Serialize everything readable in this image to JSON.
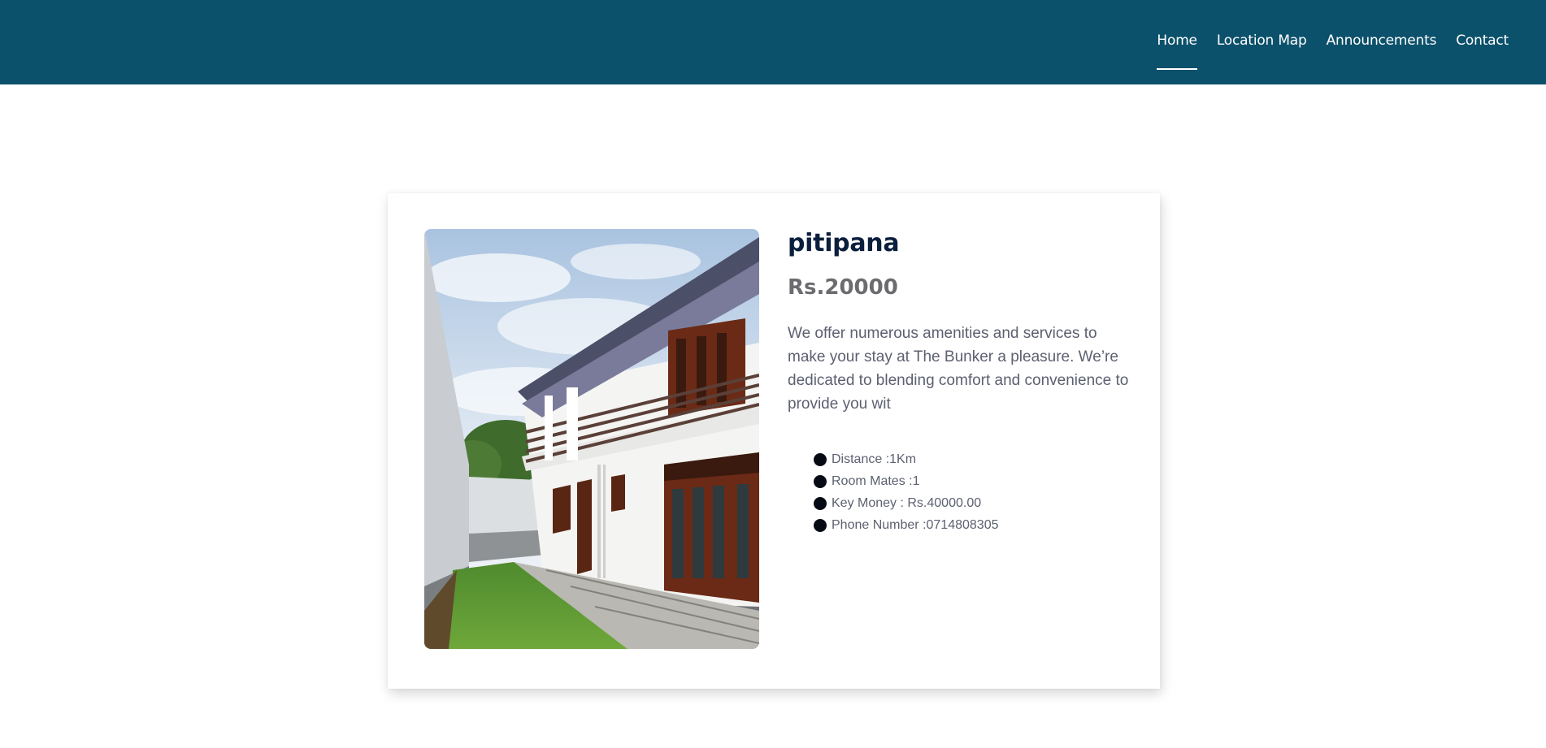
{
  "nav": {
    "items": [
      {
        "label": "Home",
        "active": true
      },
      {
        "label": "Location Map",
        "active": false
      },
      {
        "label": "Announcements",
        "active": false
      },
      {
        "label": "Contact",
        "active": false
      }
    ],
    "background_color": "#0c516b"
  },
  "listing": {
    "title": "pitipana",
    "price": "Rs.20000",
    "description": "We offer numerous amenities and services to make your stay at The Bunker a pleasure. We’re dedicated to blending comfort and convenience to provide you wit",
    "features": [
      "Distance :1Km",
      "Room Mates :1",
      "Key Money : Rs.40000.00",
      "Phone Number :0714808305"
    ],
    "photo_icon": "house-photo"
  }
}
